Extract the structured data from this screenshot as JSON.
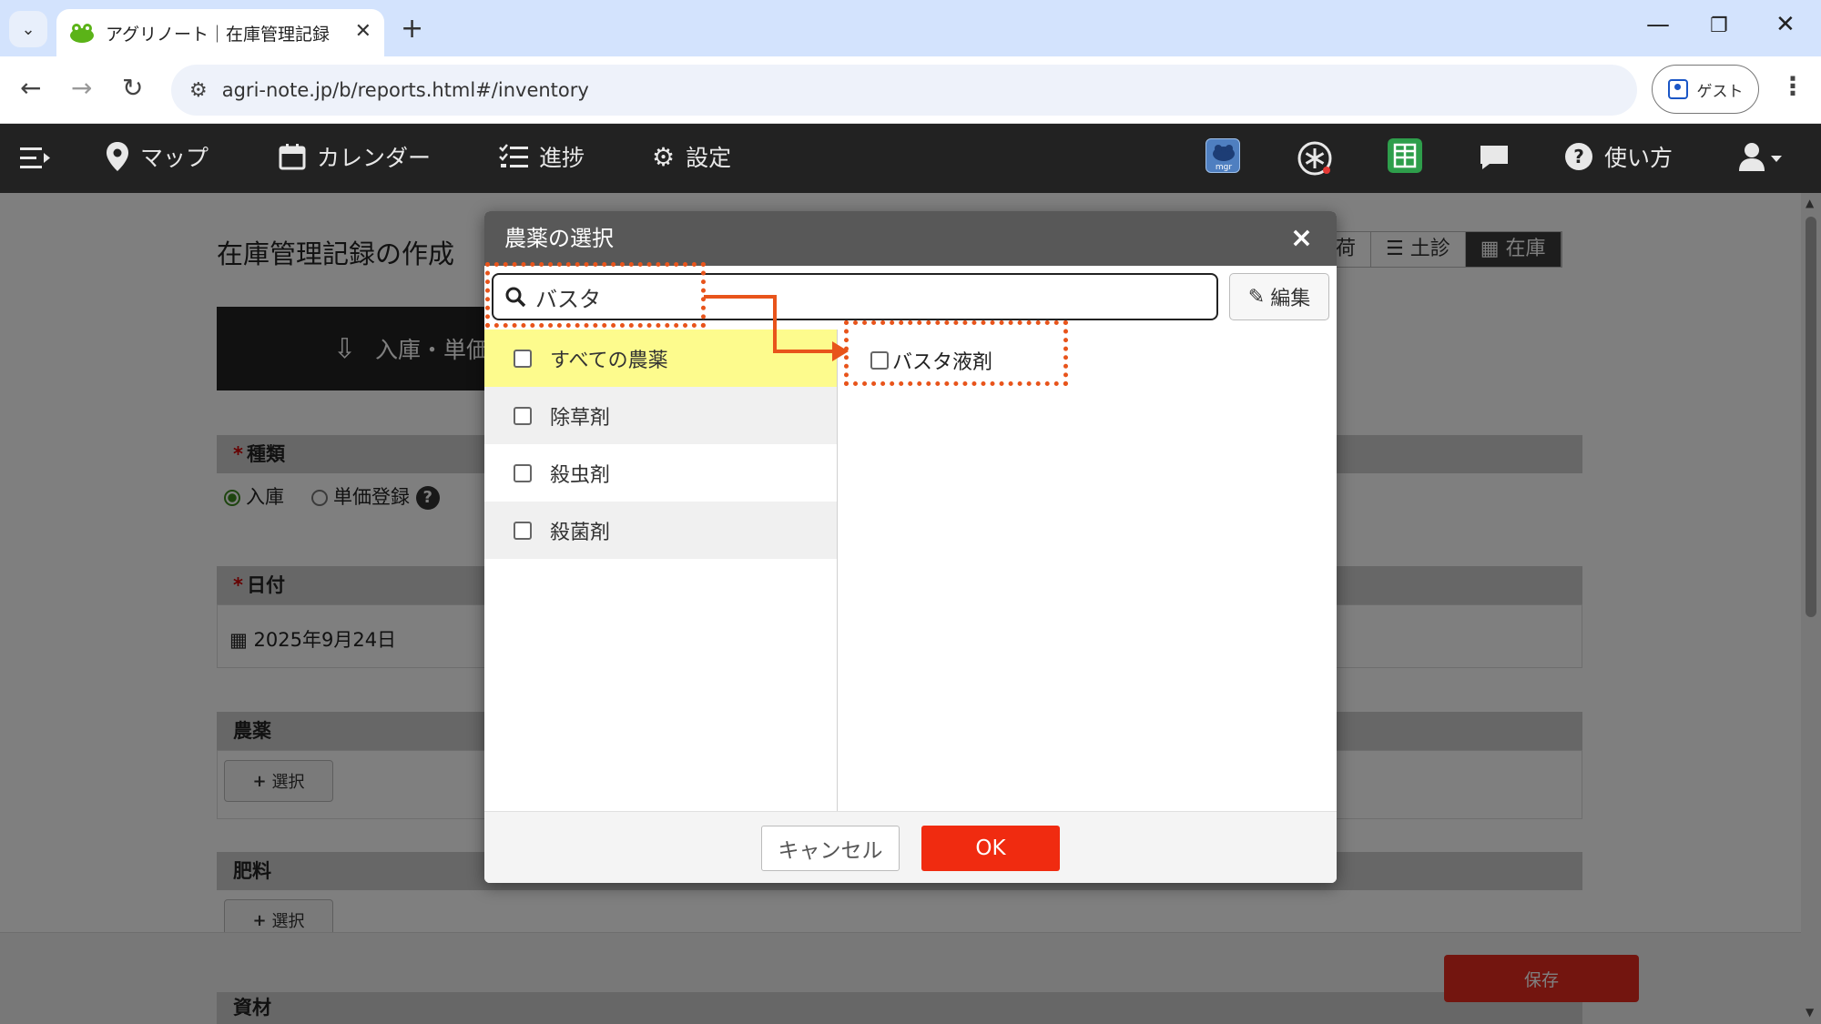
{
  "browser": {
    "tab_title": "アグリノート｜在庫管理記録",
    "url": "agri-note.jp/b/reports.html#/inventory",
    "profile_label": "ゲスト",
    "icons": [
      "chevron-down-icon",
      "close-icon",
      "plus-icon",
      "minimize-icon",
      "restore-icon",
      "close-window-icon",
      "back-icon",
      "forward-icon",
      "reload-icon",
      "site-info-icon",
      "profile-icon",
      "kebab-menu-icon"
    ]
  },
  "app_nav": {
    "items": [
      {
        "label": "マップ",
        "icon": "map-pin-icon"
      },
      {
        "label": "カレンダー",
        "icon": "calendar-icon"
      },
      {
        "label": "進捗",
        "icon": "checklist-icon"
      },
      {
        "label": "設定",
        "icon": "gear-icon"
      },
      {
        "label": "使い方",
        "icon": "help-icon"
      }
    ],
    "right_icons": [
      "mgr-icon",
      "asterisk-icon",
      "sheet-icon",
      "chat-icon",
      "user-icon"
    ],
    "mgr_text": "mgr"
  },
  "page": {
    "title": "在庫管理記録の作成",
    "top_tabs": [
      "荷",
      "土診",
      "在庫"
    ],
    "banner_label": "入庫・単価",
    "sections": {
      "kind": {
        "label": "種類",
        "options": [
          "入庫",
          "単価登録"
        ],
        "selected": "入庫"
      },
      "date": {
        "label": "日付",
        "value": "2025年9月24日"
      },
      "pesticide": {
        "label": "農薬",
        "button": "選択"
      },
      "fertilizer": {
        "label": "肥料",
        "button": "選択"
      },
      "material": {
        "label": "資材"
      }
    },
    "save_label": "保存",
    "required_mark": "*",
    "plus_mark": "+"
  },
  "modal": {
    "title": "農薬の選択",
    "close_label": "×",
    "search_value": "バスタ",
    "edit_label": "編集",
    "categories": [
      {
        "label": "すべての農薬",
        "selected": true
      },
      {
        "label": "除草剤",
        "selected": false
      },
      {
        "label": "殺虫剤",
        "selected": false
      },
      {
        "label": "殺菌剤",
        "selected": false
      }
    ],
    "results": [
      {
        "label": "バスタ液剤",
        "checked": false
      }
    ],
    "cancel_label": "キャンセル",
    "ok_label": "OK"
  },
  "colors": {
    "annotation": "#e8541b",
    "ok_button": "#f02b10",
    "selected_category": "#fdfb8d",
    "nav_bg": "#222222"
  }
}
